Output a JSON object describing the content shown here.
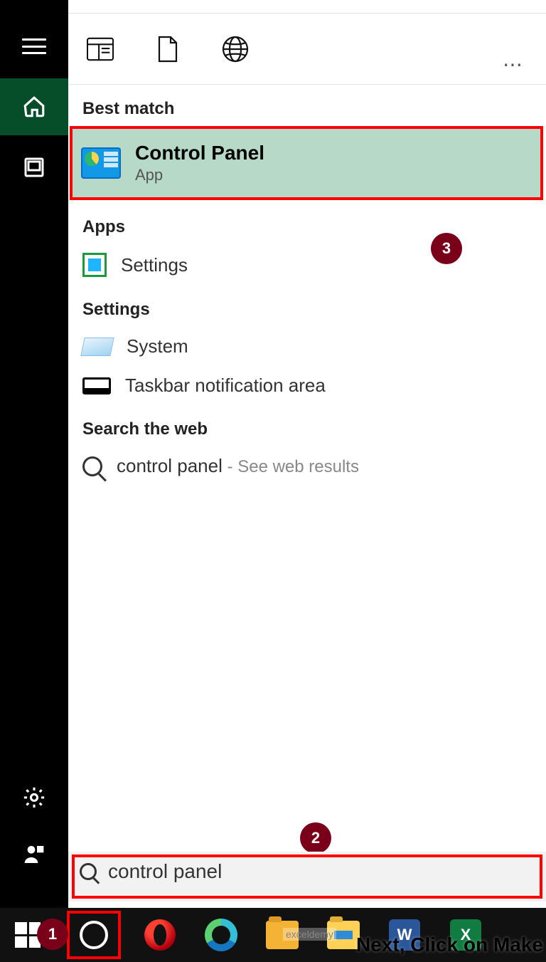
{
  "rail": {
    "menu": "menu",
    "home": "home",
    "photos": "photos",
    "settings": "settings",
    "account": "account"
  },
  "topTabs": {
    "all": "All",
    "documents": "Documents",
    "web": "Web",
    "more": "⋯"
  },
  "sections": {
    "bestMatch": "Best match",
    "apps": "Apps",
    "settings": "Settings",
    "searchWeb": "Search the web"
  },
  "bestMatch": {
    "title": "Control Panel",
    "subtitle": "App"
  },
  "appsList": {
    "settings": "Settings"
  },
  "settingsList": {
    "system": "System",
    "taskbar": "Taskbar notification area"
  },
  "webSearch": {
    "query": "control panel",
    "suffix": " - See web results"
  },
  "searchBox": {
    "value": "control panel"
  },
  "callouts": {
    "c1": "1",
    "c2": "2",
    "c3": "3"
  },
  "taskbar": {
    "wordGlyph": "W",
    "excelGlyph": "X"
  },
  "overlay": {
    "caption": "Next, Click on Make",
    "watermark": "exceldemy"
  }
}
